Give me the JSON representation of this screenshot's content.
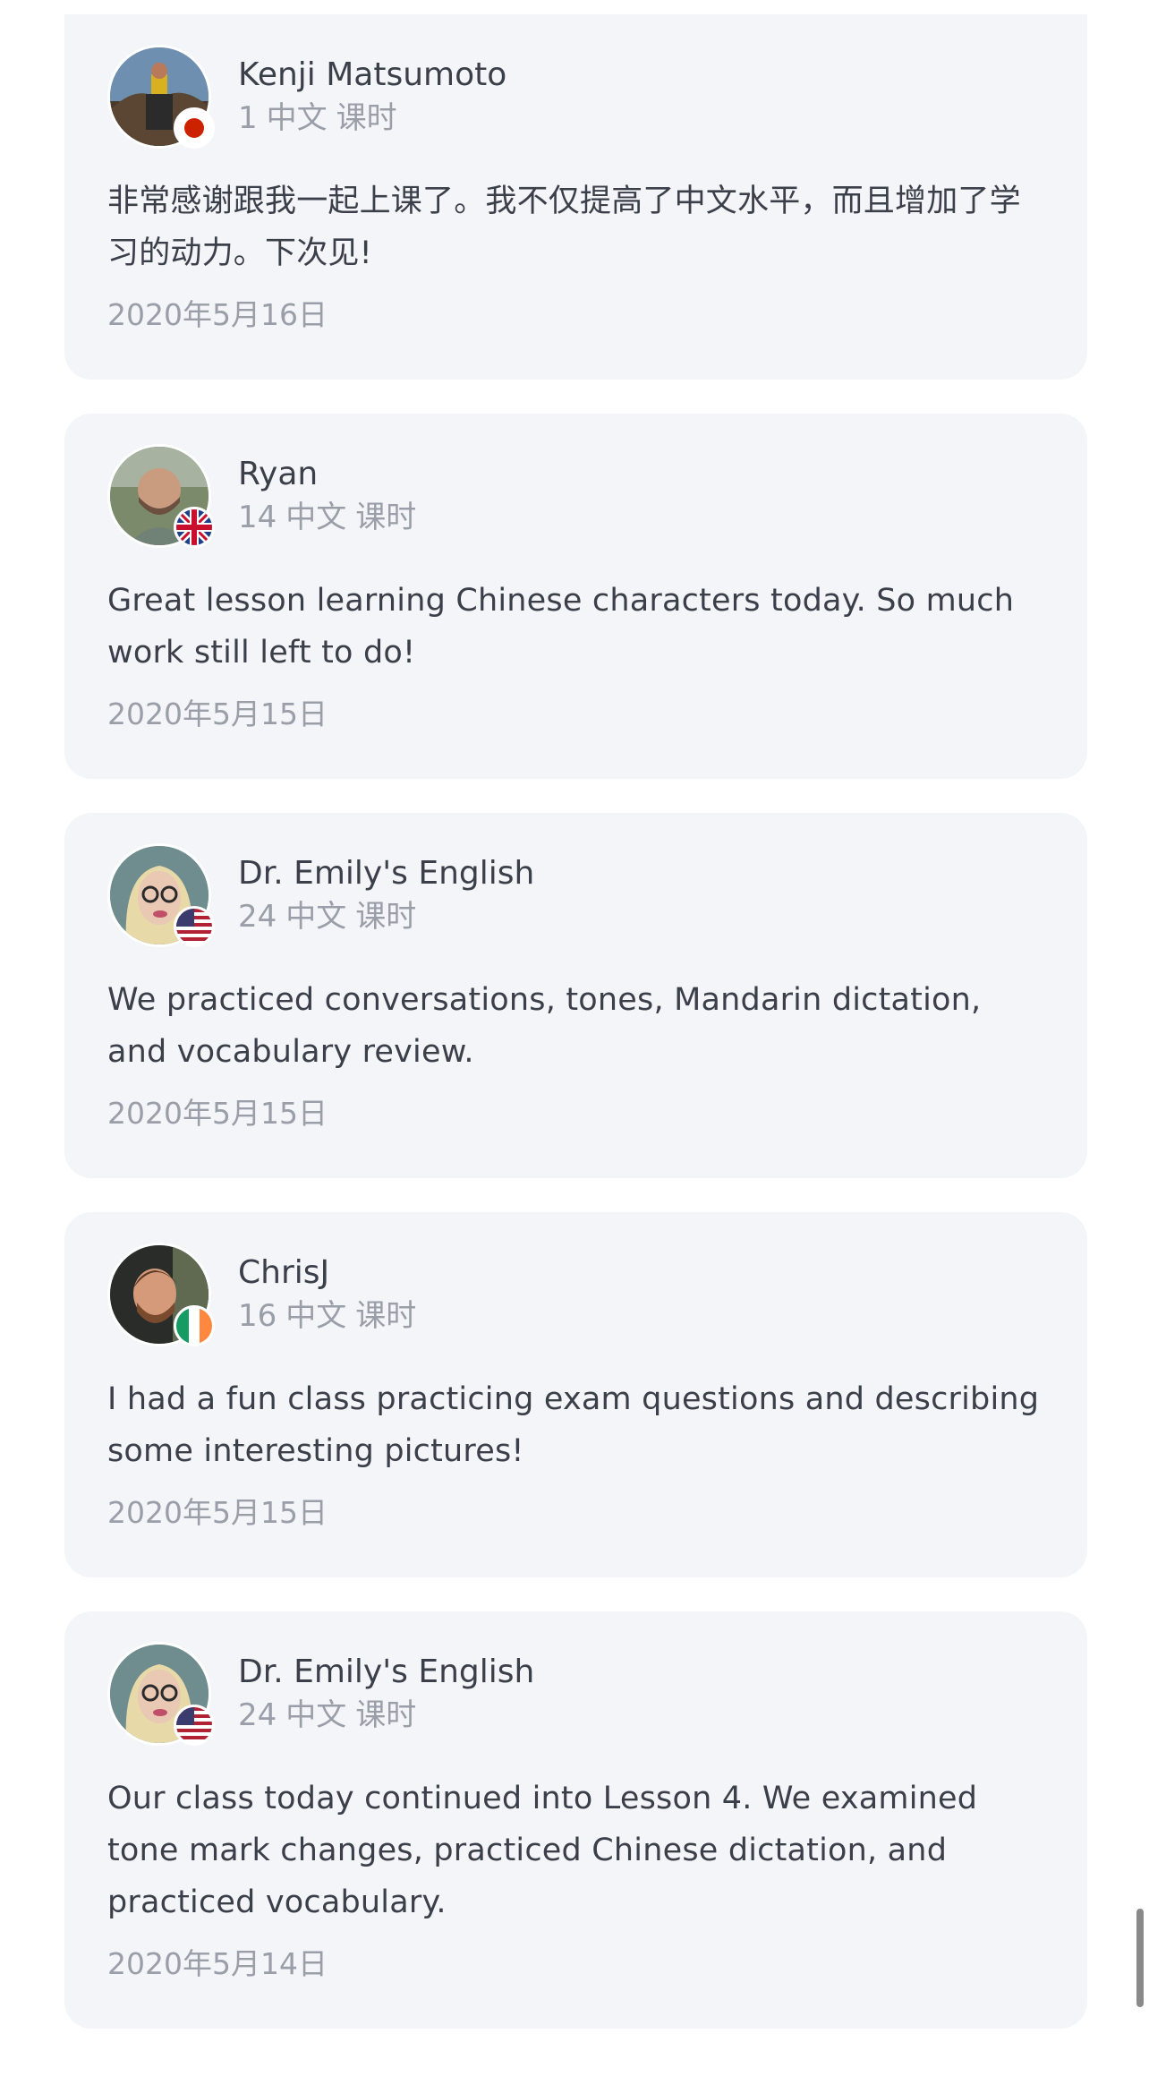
{
  "lesson_unit": "课时",
  "reviews": [
    {
      "name": "Kenji Matsumoto",
      "lesson_count": "1",
      "language": "中文",
      "text": "非常感谢跟我一起上课了。我不仅提高了中文水平，而且增加了学习的动力。下次见!",
      "date": "2020年5月16日",
      "avatar_icon": "avatar-photo-outdoor",
      "flag_icon": "japan-flag-icon"
    },
    {
      "name": "Ryan",
      "lesson_count": "14",
      "language": "中文",
      "text": "Great lesson learning Chinese characters today. So much work still left to do!",
      "date": "2020年5月15日",
      "avatar_icon": "avatar-photo-man",
      "flag_icon": "uk-flag-icon"
    },
    {
      "name": "Dr. Emily's English",
      "lesson_count": "24",
      "language": "中文",
      "text": "We practiced conversations, tones, Mandarin dictation, and vocabulary review.",
      "date": "2020年5月15日",
      "avatar_icon": "avatar-photo-woman",
      "flag_icon": "usa-flag-icon"
    },
    {
      "name": "ChrisJ",
      "lesson_count": "16",
      "language": "中文",
      "text": "I had a fun class practicing exam questions and describing some interesting pictures!",
      "date": "2020年5月15日",
      "avatar_icon": "avatar-photo-man-beard",
      "flag_icon": "ireland-flag-icon"
    },
    {
      "name": "Dr. Emily's English",
      "lesson_count": "24",
      "language": "中文",
      "text": "Our class today continued into Lesson 4. We examined tone mark changes, practiced Chinese dictation, and practiced vocabulary.",
      "date": "2020年5月14日",
      "avatar_icon": "avatar-photo-woman",
      "flag_icon": "usa-flag-icon"
    }
  ]
}
